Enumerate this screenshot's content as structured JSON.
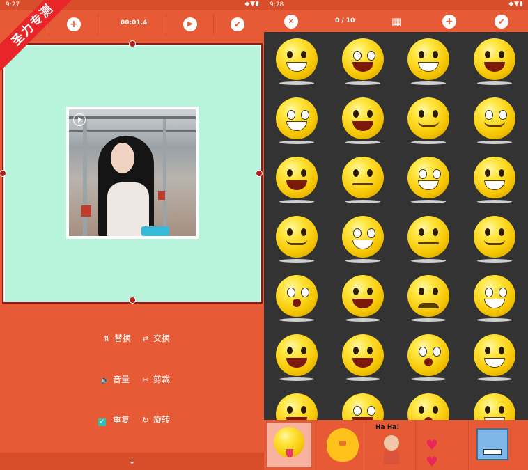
{
  "left": {
    "status": {
      "time": "9:27",
      "icons": "◆▼▮"
    },
    "toolbar": {
      "add_label": "+",
      "duration": "00:01.4",
      "play_label": "▶",
      "done_label": "✔"
    },
    "options": {
      "replace": "替换",
      "swap": "交换",
      "volume": "音量",
      "crop": "剪裁",
      "repeat": "重复",
      "rotate": "旋转"
    },
    "icons": {
      "replace": "⇅",
      "swap": "⇄",
      "volume": "🔈",
      "crop": "✂",
      "repeat": "✓",
      "rotate": "↻"
    },
    "bottom_arrow": "↓",
    "watermark": "圣力专测"
  },
  "right": {
    "status": {
      "time": "9:28",
      "icons": "◆▼▮"
    },
    "toolbar": {
      "close_label": "✕",
      "counter": "0 / 10",
      "store_label": "▦",
      "add_label": "+",
      "done_label": "✔"
    },
    "tray": {
      "haha_text": "Ha Ha!"
    }
  },
  "colors": {
    "primary": "#e65a36",
    "primary_dark": "#d84e2b",
    "canvas": "#b8f3dc",
    "grid_bg": "#333333"
  }
}
